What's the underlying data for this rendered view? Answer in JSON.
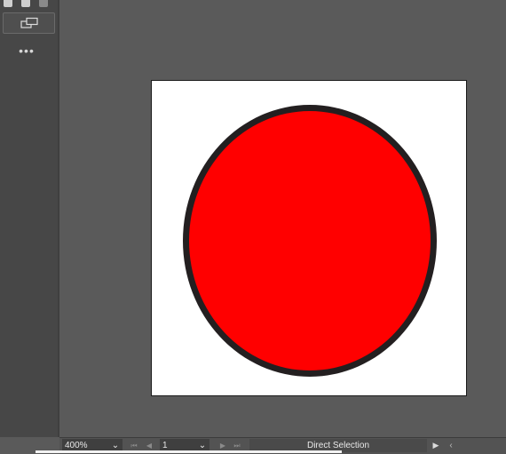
{
  "statusbar": {
    "zoom_value": "400%",
    "page_value": "1",
    "current_tool": "Direct Selection",
    "dropdown_glyph": "⌄",
    "nav_first_glyph": "⏮",
    "nav_prev_glyph": "◀",
    "nav_next_glyph": "▶",
    "nav_last_glyph": "⏭",
    "play_glyph": "▶",
    "back_glyph": "‹"
  },
  "panel": {
    "more_glyph": "•••",
    "icons": [
      "document-icon",
      "layers-icon",
      "swatch-icon",
      "change-screen-mode-icon",
      "more-icon"
    ]
  },
  "canvas": {
    "artboard_color": "#ffffff",
    "shape_fill": "#ff0000",
    "shape_stroke": "#231f20",
    "workspace_color": "#5a5a5a"
  }
}
